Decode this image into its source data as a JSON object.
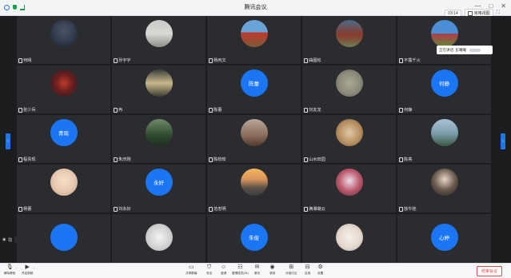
{
  "window": {
    "title": "腾讯会议",
    "controls": [
      "—",
      "□",
      "✕"
    ]
  },
  "meeting": {
    "timer": "03:14",
    "view_label": "宫格视图"
  },
  "tooltip": {
    "speaking_label": "正在讲话: 彭曦曦"
  },
  "float_controls": {
    "label": "隐"
  },
  "participants": [
    {
      "name": "何晴"
    },
    {
      "name": "孙宇宇"
    },
    {
      "name": "杨丙文"
    },
    {
      "name": "曲图松"
    },
    {
      "name": "不露千火"
    },
    {
      "name": "张少兵"
    },
    {
      "name": "冉"
    },
    {
      "name": "陈蕾",
      "avatar_text": "陈蕾"
    },
    {
      "name": "刘友龙"
    },
    {
      "name": "何静",
      "avatar_text": "何静"
    },
    {
      "name": "程青现",
      "avatar_text": "青现"
    },
    {
      "name": "朱庆刚"
    },
    {
      "name": "陈皎皎"
    },
    {
      "name": "山水田园"
    },
    {
      "name": "陈亮"
    },
    {
      "name": "杨蕾"
    },
    {
      "name": "刘永好",
      "avatar_text": "永好"
    },
    {
      "name": "范忠明"
    },
    {
      "name": "满湘璐云"
    },
    {
      "name": "放牛娃"
    },
    {
      "name": "",
      "avatar_text": ""
    },
    {
      "name": ""
    },
    {
      "name": "",
      "avatar_text": "朱俊"
    },
    {
      "name": ""
    },
    {
      "name": "",
      "avatar_text": "心婷"
    }
  ],
  "toolbar": {
    "mute": "解除静音",
    "video": "开启视频",
    "items": [
      "共享屏幕",
      "安全",
      "邀请",
      "管理成员(51)",
      "聊天",
      "录制",
      "分组讨论",
      "应用",
      "设置"
    ],
    "leave": "结束会议"
  },
  "colors": {
    "accent": "#1a76f4",
    "danger": "#e04545",
    "tile_bg": "#2b2c2f"
  }
}
